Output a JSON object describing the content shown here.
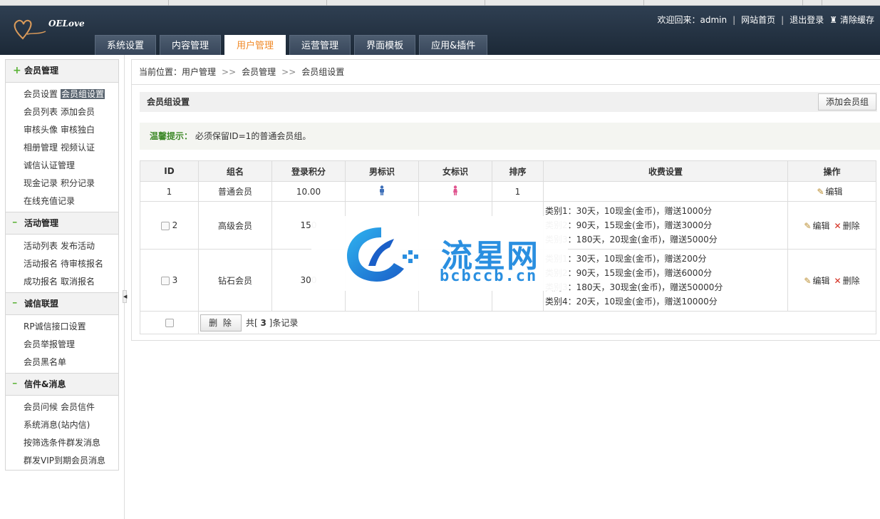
{
  "header": {
    "logo_text": "OELove",
    "welcome": "欢迎回来：admin",
    "site_home": "网站首页",
    "logout": "退出登录",
    "clear_cache": "清除缓存",
    "tabs": [
      {
        "label": "系统设置",
        "active": false
      },
      {
        "label": "内容管理",
        "active": false
      },
      {
        "label": "用户管理",
        "active": true
      },
      {
        "label": "运营管理",
        "active": false
      },
      {
        "label": "界面模板",
        "active": false
      },
      {
        "label": "应用&插件",
        "active": false
      }
    ]
  },
  "sidebar": {
    "sections": [
      {
        "title": "会员管理",
        "icon": "plus-icon",
        "rows": [
          [
            "会员设置",
            "会员组设置"
          ],
          [
            "会员列表",
            "添加会员"
          ],
          [
            "审核头像",
            "审核独白"
          ],
          [
            "相册管理",
            "视频认证"
          ],
          [
            "诚信认证管理"
          ],
          [
            "现金记录",
            "积分记录"
          ],
          [
            "在线充值记录"
          ]
        ]
      },
      {
        "title": "活动管理",
        "icon": "minus-icon",
        "rows": [
          [
            "活动列表",
            "发布活动"
          ],
          [
            "活动报名",
            "待审核报名"
          ],
          [
            "成功报名",
            "取消报名"
          ]
        ]
      },
      {
        "title": "诚信联盟",
        "icon": "minus-icon",
        "rows": [
          [
            "RP诚信接口设置"
          ],
          [
            "会员举报管理"
          ],
          [
            "会员黑名单"
          ]
        ]
      },
      {
        "title": "信件&消息",
        "icon": "minus-icon",
        "rows": [
          [
            "会员问候",
            "会员信件"
          ],
          [
            "系统消息(站内信)"
          ],
          [
            "按筛选条件群发消息"
          ],
          [
            "群发VIP到期会员消息"
          ]
        ]
      }
    ],
    "highlight": "会员组设置"
  },
  "breadcrumb": {
    "prefix": "当前位置：",
    "items": [
      "用户管理",
      "会员管理",
      "会员组设置"
    ],
    "sep": ">>"
  },
  "panel": {
    "title": "会员组设置",
    "add_button": "添加会员组",
    "tip_label": "温馨提示：",
    "tip_text": "必须保留ID=1的普通会员组。"
  },
  "table": {
    "headers": [
      "ID",
      "组名",
      "登录积分",
      "男标识",
      "女标识",
      "排序",
      "收费设置",
      "操作"
    ],
    "rows": [
      {
        "id": "1",
        "name": "普通会员",
        "points": "10.00",
        "order": "1",
        "fees": [],
        "checkbox": false,
        "can_delete": false
      },
      {
        "id": "2",
        "name": "高级会员",
        "points": "150",
        "order": "",
        "fees": [
          "类别1：30天，10现金(金币)，赠送1000分",
          "类别2：90天，15现金(金币)，赠送3000分",
          "类别3：180天，20现金(金币)，赠送5000分"
        ],
        "checkbox": true,
        "can_delete": true
      },
      {
        "id": "3",
        "name": "钻石会员",
        "points": "300",
        "order": "",
        "fees": [
          "类别1：30天，10现金(金币)，赠送200分",
          "类别2：90天，15现金(金币)，赠送6000分",
          "类别3：180天，30现金(金币)，赠送50000分",
          "类别4：20天，10现金(金币)，赠送10000分"
        ],
        "checkbox": true,
        "can_delete": true
      }
    ],
    "edit_label": "编辑",
    "delete_label": "删除",
    "footer": {
      "delete_button": "删 除",
      "total_prefix": "共[ ",
      "total_count": "3",
      "total_suffix": " ]条记录"
    }
  },
  "watermark": {
    "cn": "流星网",
    "en": "bcbccb.cn"
  },
  "colors": {
    "header_bg": "#26354a",
    "active_tab": "#f08a28",
    "tip_label": "#3f8a2a",
    "delete_x": "#d32a1c",
    "male": "#3d6fb8",
    "female": "#e0558f",
    "watermark": "#2a8fe0"
  }
}
